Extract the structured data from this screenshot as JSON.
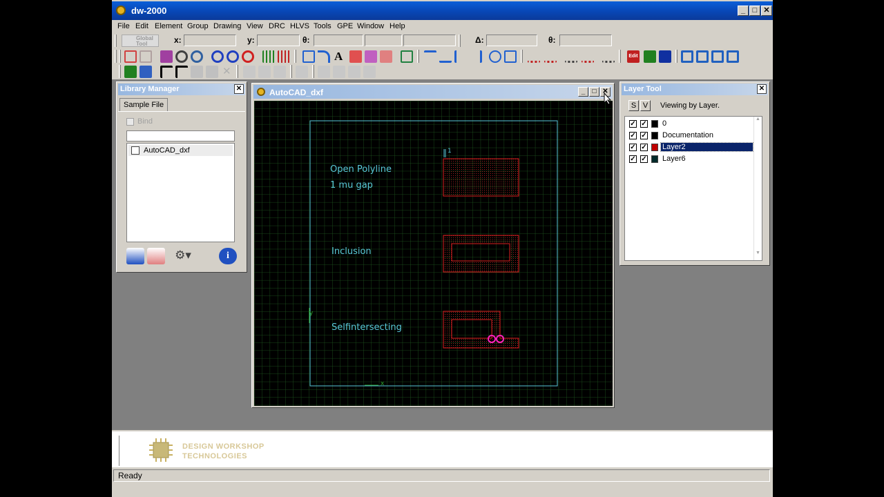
{
  "app": {
    "title": "dw-2000"
  },
  "menu": [
    "File",
    "Edit",
    "Element",
    "Group",
    "Drawing",
    "View",
    "DRC",
    "HLVS",
    "Tools",
    "GPE",
    "Window",
    "Help"
  ],
  "coords": {
    "global_label": "Global\nTool",
    "x_label": "x:",
    "y_label": "y:",
    "theta_label": "θ:",
    "delta_label": "Δ:",
    "theta2_label": "θ:"
  },
  "library_manager": {
    "title": "Library Manager",
    "tab": "Sample File",
    "bind_label": "Bind",
    "items": [
      "AutoCAD_dxf"
    ]
  },
  "cad_window": {
    "title": "AutoCAD_dxf",
    "labels": {
      "open_polyline": "Open Polyline",
      "gap": "1 mu gap",
      "inclusion": "Inclusion",
      "selfintersecting": "Selfintersecting",
      "pin": "1"
    }
  },
  "layer_tool": {
    "title": "Layer Tool",
    "s_label": "S",
    "v_label": "V",
    "status": "Viewing by Layer.",
    "layers": [
      {
        "name": "0",
        "color": "#000000",
        "selected": false
      },
      {
        "name": "Documentation",
        "color": "#000000",
        "selected": false
      },
      {
        "name": "Layer2",
        "color": "#c00000",
        "selected": true
      },
      {
        "name": "Layer6",
        "color": "#002a2a",
        "selected": false
      }
    ]
  },
  "logo": {
    "line1": "DESIGN WORKSHOP",
    "line2": "TECHNOLOGIES"
  },
  "status": {
    "text": "Ready"
  },
  "colors": {
    "titlebar": "#0a5fd8",
    "cyan": "#59c8d8",
    "red": "#e02020",
    "grid": "#1f5a1f",
    "selection": "#0a246a",
    "magenta": "#ff20c0"
  }
}
